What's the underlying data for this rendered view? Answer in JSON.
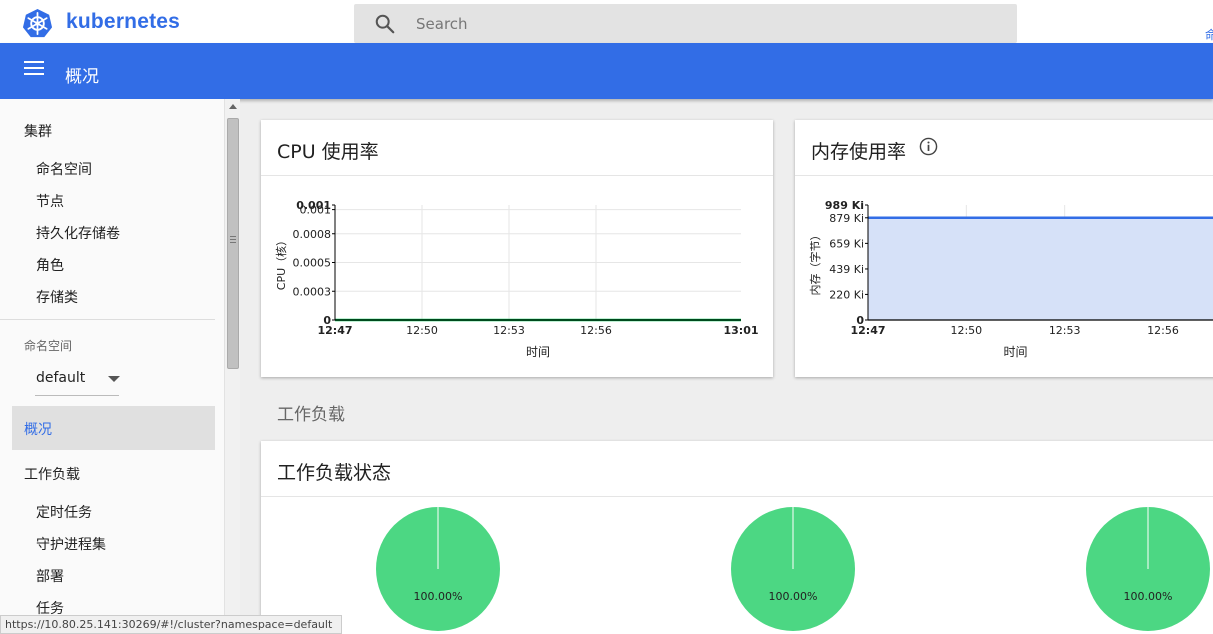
{
  "brand": {
    "name": "kubernetes"
  },
  "search": {
    "placeholder": "Search"
  },
  "corner": {
    "glyph": "命"
  },
  "header": {
    "title": "概况"
  },
  "sidebar": {
    "cluster": {
      "label": "集群",
      "items": [
        "命名空间",
        "节点",
        "持久化存储卷",
        "角色",
        "存储类"
      ]
    },
    "namespace": {
      "label": "命名空间",
      "selected": "default"
    },
    "overview": "概况",
    "workloads": {
      "label": "工作负载",
      "items": [
        "定时任务",
        "守护进程集",
        "部署",
        "任务"
      ]
    }
  },
  "cards": {
    "cpu": {
      "title": "CPU 使用率"
    },
    "memory": {
      "title": "内存使用率"
    },
    "workload_status": {
      "title": "工作负载状态"
    }
  },
  "section": {
    "workloads": "工作负载"
  },
  "statusbar": {
    "url": "https://10.80.25.141:30269/#!/cluster?namespace=default"
  },
  "colors": {
    "accent": "#326de6",
    "cpu_line": "#00c752",
    "memory_line": "#326de6",
    "memory_fill": "#d6e1f8",
    "pie_fill": "#4cd783"
  },
  "icons": [
    "kubernetes-logo-icon",
    "search-icon",
    "menu-icon",
    "info-icon",
    "chevron-down-icon",
    "scroll-up-icon"
  ],
  "chart_data": [
    {
      "type": "line",
      "id": "cpu",
      "x": [
        "12:47",
        "12:50",
        "12:53",
        "12:56",
        "13:01"
      ],
      "x_minutes": [
        0,
        3,
        6,
        9,
        14
      ],
      "series": [
        {
          "values": [
            0,
            0,
            0,
            0,
            0
          ]
        }
      ],
      "yticks": [
        "0.001",
        "0.001",
        "0.0008",
        "0.0005",
        "0.0003",
        "0"
      ],
      "ytick_values": [
        0.001,
        0.00096,
        0.00075,
        0.0005,
        0.00025,
        0
      ],
      "ylim": [
        0,
        0.001
      ],
      "xlabel": "时间",
      "ylabel": "CPU（核）",
      "grid": true
    },
    {
      "type": "area",
      "id": "memory",
      "x": [
        "12:47",
        "12:50",
        "12:53",
        "12:56"
      ],
      "x_minutes": [
        0,
        3,
        6,
        9
      ],
      "series": [
        {
          "values": [
            879,
            879,
            879,
            879
          ]
        }
      ],
      "yticks": [
        "989 Ki",
        "879 Ki",
        "659 Ki",
        "439 Ki",
        "220 Ki",
        "0"
      ],
      "ytick_values": [
        989,
        879,
        659,
        439,
        220,
        0
      ],
      "ylim": [
        0,
        989
      ],
      "xlabel": "时间",
      "ylabel": "内存（字节）",
      "grid": true
    },
    {
      "type": "pie",
      "id": "workload-status",
      "slices": [
        {
          "label": "100.00%",
          "value": 100
        },
        {
          "label": "100.00%",
          "value": 100
        },
        {
          "label": "100.00%",
          "value": 100
        }
      ]
    }
  ]
}
